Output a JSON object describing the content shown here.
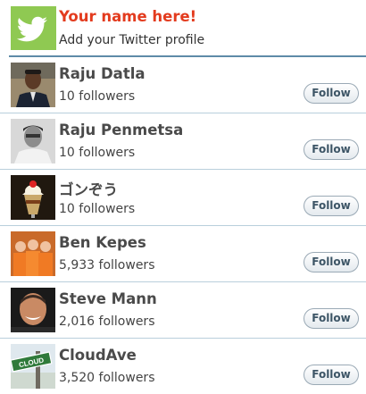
{
  "profile": {
    "name": "Your name here!",
    "subtitle": "Add your Twitter profile",
    "icon": "twitter-bird-icon",
    "accent_color": "#8fc952",
    "name_color": "#e33b1e"
  },
  "follow_label": "Follow",
  "users": [
    {
      "name": "Raju Datla",
      "followers": "10 followers",
      "avatar": "man-in-suit-avatar"
    },
    {
      "name": "Raju Penmetsa",
      "followers": "10 followers",
      "avatar": "grayscale-man-avatar"
    },
    {
      "name": "ゴンぞう",
      "followers": "10 followers",
      "avatar": "ice-cream-sundae-avatar"
    },
    {
      "name": "Ben Kepes",
      "followers": "5,933 followers",
      "avatar": "group-in-orange-avatar"
    },
    {
      "name": "Steve Mann",
      "followers": "2,016 followers",
      "avatar": "smiling-man-avatar"
    },
    {
      "name": "CloudAve",
      "followers": "3,520 followers",
      "avatar": "cloud-street-sign-avatar"
    }
  ]
}
